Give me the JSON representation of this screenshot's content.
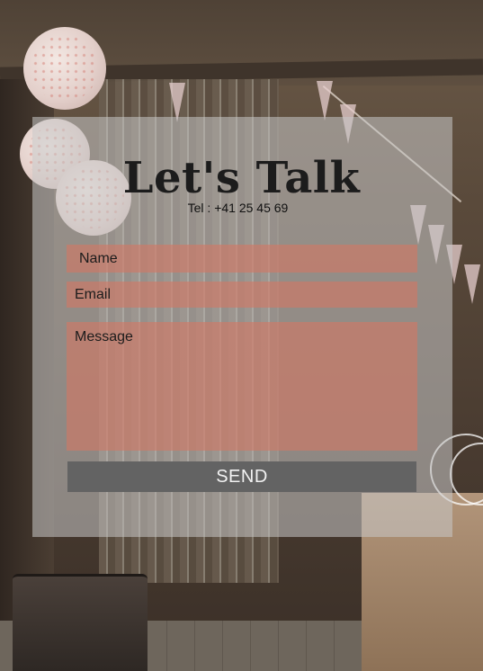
{
  "contact": {
    "heading": "Let's Talk",
    "phone": "Tel : +41 25 45 69"
  },
  "form": {
    "name_placeholder": "Name",
    "email_placeholder": "Email",
    "message_placeholder": "Message",
    "send_label": "SEND"
  },
  "colors": {
    "field_fill": "#d27864",
    "button_fill": "#636363",
    "card_fill": "#c8c8c8"
  }
}
